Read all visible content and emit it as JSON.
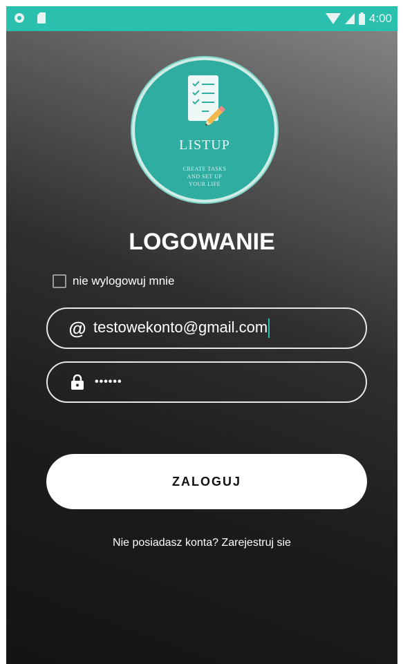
{
  "status_bar": {
    "time": "4:00",
    "icons": [
      "circle-notification-icon",
      "sd-card-icon",
      "wifi-icon",
      "signal-icon",
      "battery-icon"
    ],
    "background_color": "#2ac0ad"
  },
  "logo": {
    "icon": "checklist-pencil-icon",
    "title": "LISTUP",
    "tagline_line1": "CREATE TASKS",
    "tagline_line2": "AND SET UP",
    "tagline_line3": "YOUR LIFE",
    "color": "#2fada0"
  },
  "heading": "LOGOWANIE",
  "remember_me": {
    "label": "nie wylogowuj mnie",
    "checked": false
  },
  "email_field": {
    "icon": "at-sign-icon",
    "icon_glyph": "@",
    "value": "testowekonto@gmail.com"
  },
  "password_field": {
    "icon": "lock-icon",
    "masked_value": "••••••"
  },
  "login_button": {
    "label": "ZALOGUJ"
  },
  "register_link": {
    "label": "Nie posiadasz konta? Zarejestruj sie"
  },
  "accent_color": "#2ac0ad"
}
